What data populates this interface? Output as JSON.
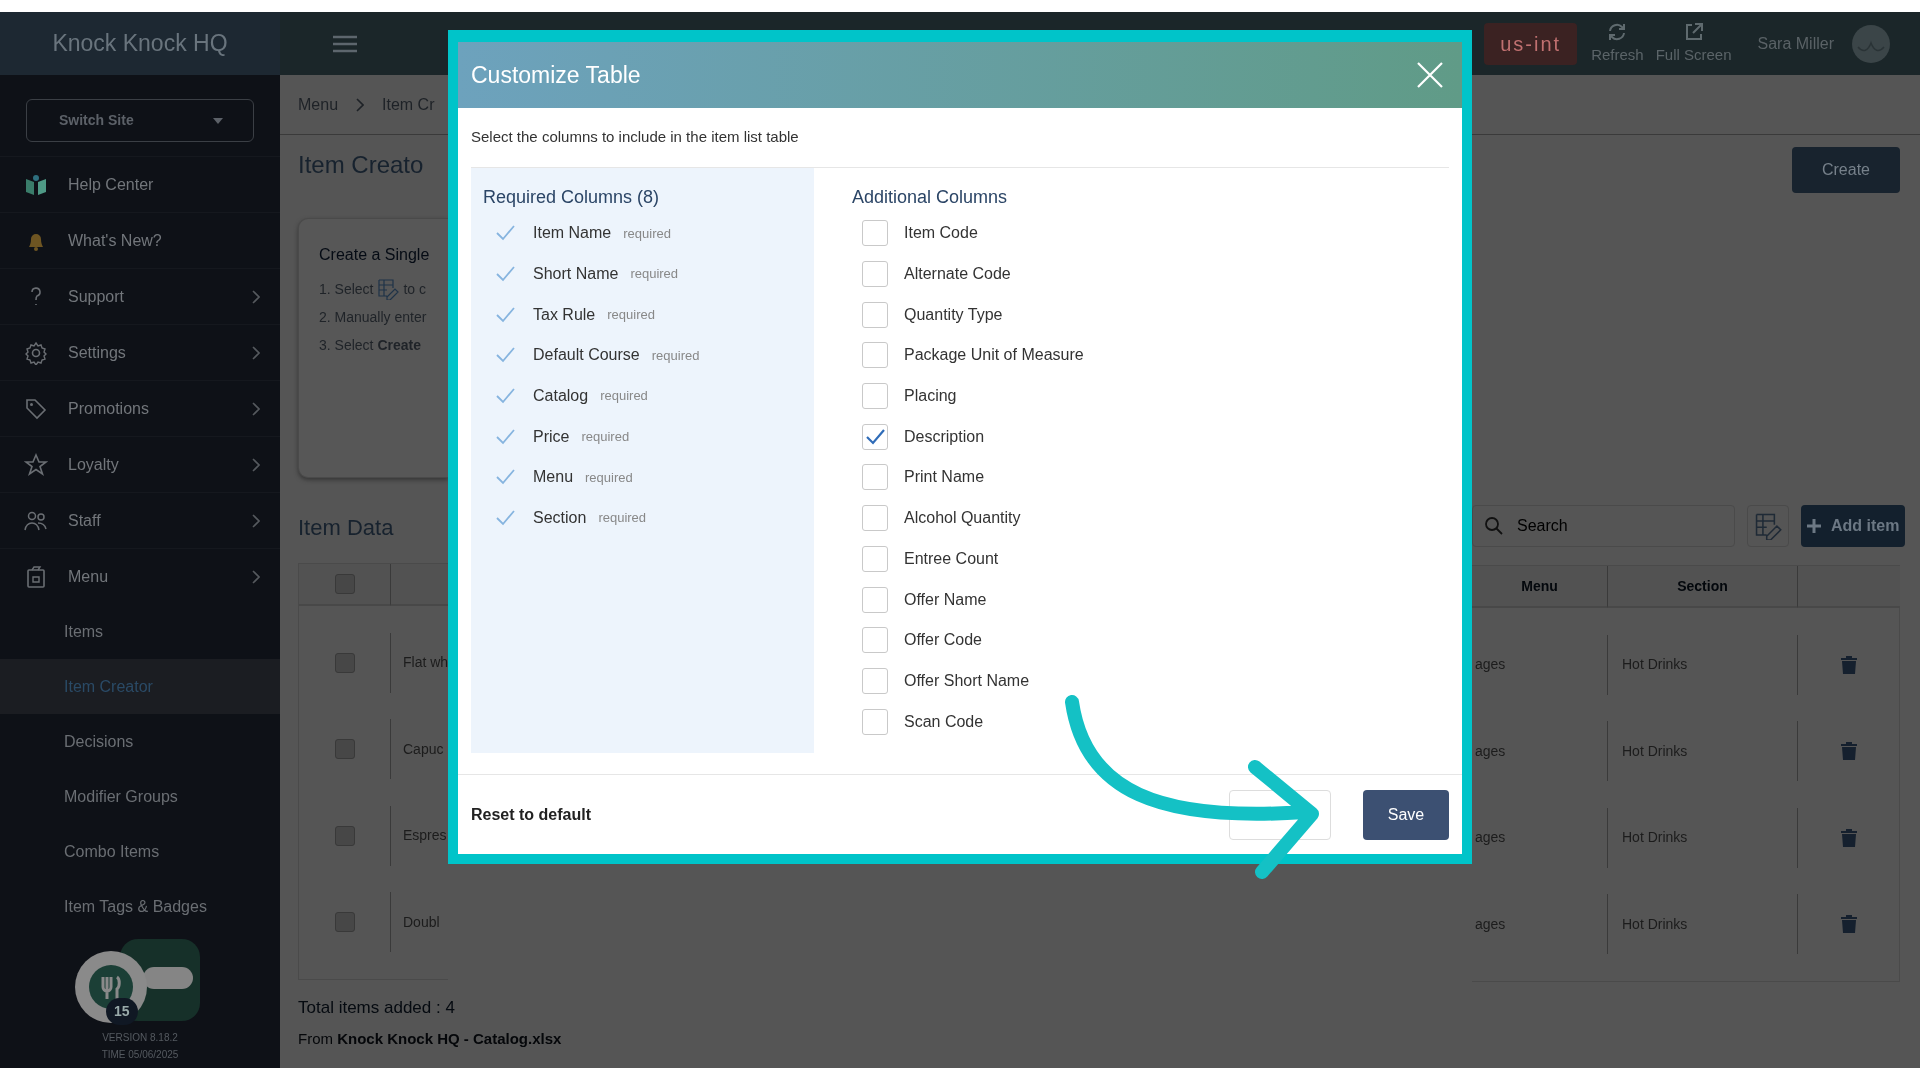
{
  "top_bar": {
    "brand": "Knock Knock HQ",
    "badges": [
      {
        "label": "us-int"
      }
    ],
    "actions": [
      {
        "label": "Refresh"
      },
      {
        "label": "Full Screen"
      }
    ],
    "user": "Sara Miller"
  },
  "sidebar": {
    "site_switcher": "Switch Site",
    "items": [
      {
        "label": "Help Center",
        "expandable": false
      },
      {
        "label": "What's New?",
        "expandable": false
      },
      {
        "label": "Support",
        "expandable": true
      },
      {
        "label": "Settings",
        "expandable": true
      },
      {
        "label": "Promotions",
        "expandable": true
      },
      {
        "label": "Loyalty",
        "expandable": true
      },
      {
        "label": "Staff",
        "expandable": true
      },
      {
        "label": "Menu",
        "expandable": true
      }
    ],
    "subitems": [
      {
        "label": "Items",
        "selected": false
      },
      {
        "label": "Item Creator",
        "selected": true
      },
      {
        "label": "Decisions",
        "selected": false
      },
      {
        "label": "Modifier Groups",
        "selected": false
      },
      {
        "label": "Combo Items",
        "selected": false
      },
      {
        "label": "Item Tags & Badges",
        "selected": false
      }
    ],
    "notification_count": "15",
    "version": "VERSION 8.18.2",
    "time": "TIME 05/06/2025"
  },
  "main": {
    "breadcrumbs": [
      "Menu",
      "Item Cr"
    ],
    "page_title": "Item Creato",
    "create_button": "Create",
    "card": {
      "title": "Create a Single",
      "steps": [
        {
          "kind": "icon",
          "before": "1. Select",
          "after": "to c"
        },
        {
          "kind": "text",
          "text": "2. Manually enter"
        },
        {
          "kind": "text",
          "text": "3. Select **Create**"
        }
      ]
    },
    "item_data": {
      "title": "Item Data",
      "search": {
        "placeholder": "Search"
      },
      "add_button": "Add item",
      "header_checked": false,
      "columns": [
        "Menu",
        "Section"
      ],
      "rows": [
        {
          "checked": false,
          "name": "Flat wh",
          "menu": "ages",
          "section": "Hot Drinks"
        },
        {
          "checked": false,
          "name": "Capuc",
          "menu": "ages",
          "section": "Hot Drinks"
        },
        {
          "checked": false,
          "name": "Espres",
          "menu": "ages",
          "section": "Hot Drinks"
        },
        {
          "checked": false,
          "name": "Doubl",
          "menu": "ages",
          "section": "Hot Drinks"
        }
      ]
    },
    "total": "Total items added : 4",
    "source": "From **Knock Knock HQ - Catalog.xlsx**"
  },
  "modal": {
    "title": "Customize Table",
    "subtitle": "Select the columns to include in the item list table",
    "required": {
      "title": "Required Columns (8)",
      "items": [
        {
          "label": "Item Name",
          "note": "required",
          "checked": true
        },
        {
          "label": "Short Name",
          "note": "required",
          "checked": true
        },
        {
          "label": "Tax Rule",
          "note": "required",
          "checked": true
        },
        {
          "label": "Default Course",
          "note": "required",
          "checked": true
        },
        {
          "label": "Catalog",
          "note": "required",
          "checked": true
        },
        {
          "label": "Price",
          "note": "required",
          "checked": true
        },
        {
          "label": "Menu",
          "note": "required",
          "checked": true
        },
        {
          "label": "Section",
          "note": "required",
          "checked": true
        }
      ]
    },
    "additional": {
      "title": "Additional Columns",
      "items": [
        {
          "label": "Item Code",
          "checked": false
        },
        {
          "label": "Alternate Code",
          "checked": false
        },
        {
          "label": "Quantity Type",
          "checked": false
        },
        {
          "label": "Package Unit of Measure",
          "checked": false
        },
        {
          "label": "Placing",
          "checked": false
        },
        {
          "label": "Description",
          "checked": true
        },
        {
          "label": "Print Name",
          "checked": false
        },
        {
          "label": "Alcohol Quantity",
          "checked": false
        },
        {
          "label": "Entree Count",
          "checked": false
        },
        {
          "label": "Offer Name",
          "checked": false
        },
        {
          "label": "Offer Code",
          "checked": false
        },
        {
          "label": "Offer Short Name",
          "checked": false
        },
        {
          "label": "Scan Code",
          "checked": false
        }
      ]
    },
    "reset": "Reset to default",
    "save": "Save"
  }
}
